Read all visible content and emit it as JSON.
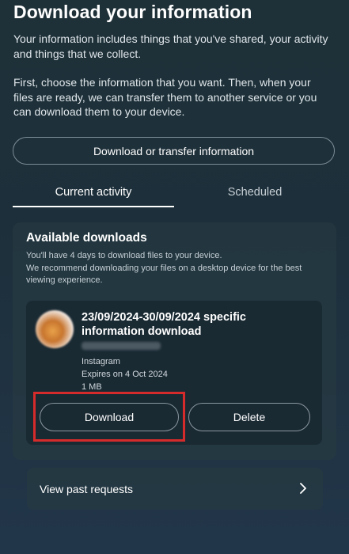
{
  "header": {
    "title": "Download your information",
    "intro": "Your information includes things that you've shared, your activity and things that we collect.",
    "instructions": "First, choose the information that you want. Then, when your files are ready, we can transfer them to another service or you can download them to your device."
  },
  "actions": {
    "download_transfer_label": "Download or transfer information"
  },
  "tabs": [
    {
      "label": "Current activity",
      "selected": true
    },
    {
      "label": "Scheduled",
      "selected": false
    }
  ],
  "available": {
    "title": "Available downloads",
    "line1": "You'll have 4 days to download files to your device.",
    "line2": "We recommend downloading your files on a desktop device for the best viewing experience."
  },
  "download_item": {
    "title": "23/09/2024-30/09/2024 specific information download",
    "source": "Instagram",
    "expires": "Expires on 4 Oct 2024",
    "size": "1 MB",
    "download_label": "Download",
    "delete_label": "Delete"
  },
  "past_requests": {
    "label": "View past requests"
  },
  "colors": {
    "highlight": "#d62b2b",
    "background": "#1f3138"
  }
}
